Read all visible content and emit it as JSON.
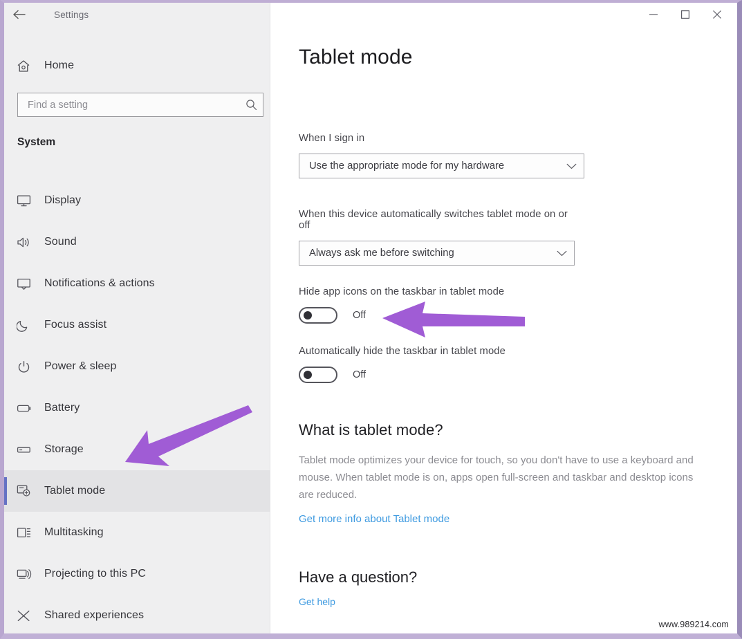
{
  "window": {
    "title": "Settings",
    "back_icon": "back-arrow-icon",
    "controls": [
      {
        "name": "minimize",
        "glyph": "minimize-icon"
      },
      {
        "name": "maximize",
        "glyph": "maximize-icon"
      },
      {
        "name": "close",
        "glyph": "close-icon"
      }
    ]
  },
  "sidebar": {
    "home_label": "Home",
    "home_icon": "home-icon",
    "search": {
      "placeholder": "Find a setting",
      "value": "",
      "icon": "search-icon"
    },
    "section_heading": "System",
    "selected_item": "Tablet mode",
    "accent_color": "#6572c4",
    "items": [
      {
        "label": "Display",
        "icon": "monitor-icon",
        "selected": false
      },
      {
        "label": "Sound",
        "icon": "speaker-icon",
        "selected": false
      },
      {
        "label": "Notifications & actions",
        "icon": "notification-icon",
        "selected": false
      },
      {
        "label": "Focus assist",
        "icon": "moon-icon",
        "selected": false
      },
      {
        "label": "Power & sleep",
        "icon": "power-icon",
        "selected": false
      },
      {
        "label": "Battery",
        "icon": "battery-icon",
        "selected": false
      },
      {
        "label": "Storage",
        "icon": "storage-icon",
        "selected": false
      },
      {
        "label": "Tablet mode",
        "icon": "tablet-mode-icon",
        "selected": true
      },
      {
        "label": "Multitasking",
        "icon": "multitasking-icon",
        "selected": false
      },
      {
        "label": "Projecting to this PC",
        "icon": "projecting-icon",
        "selected": false
      },
      {
        "label": "Shared experiences",
        "icon": "shared-experiences-icon",
        "selected": false
      }
    ]
  },
  "main": {
    "page_title": "Tablet mode",
    "sign_in": {
      "label": "When I sign in",
      "value": "Use the appropriate mode for my hardware",
      "chevron_icon": "chevron-down-icon"
    },
    "auto_switch": {
      "label": "When this device automatically switches tablet mode on or off",
      "value": "Always ask me before switching",
      "chevron_icon": "chevron-down-icon"
    },
    "hide_app_icons": {
      "label": "Hide app icons on the taskbar in tablet mode",
      "state": "Off"
    },
    "auto_hide_taskbar": {
      "label": "Automatically hide the taskbar in tablet mode",
      "state": "Off"
    },
    "what_is": {
      "heading": "What is tablet mode?",
      "body": "Tablet mode optimizes your device for touch, so you don't have to use a keyboard and mouse. When tablet mode is on, apps open full-screen and taskbar and desktop icons are reduced.",
      "link": "Get more info about Tablet mode"
    },
    "have_question": {
      "heading": "Have a question?",
      "link": "Get help"
    },
    "link_color": "#3e9ae0"
  },
  "annotations": {
    "arrow_color": "#a05cd5",
    "arrows": [
      {
        "name": "arrow-to-hide-app-icons-toggle",
        "points_to": "hide app icons toggle"
      },
      {
        "name": "arrow-to-tablet-mode-nav",
        "points_to": "Tablet mode sidebar item"
      }
    ]
  },
  "watermark": "www.989214.com"
}
